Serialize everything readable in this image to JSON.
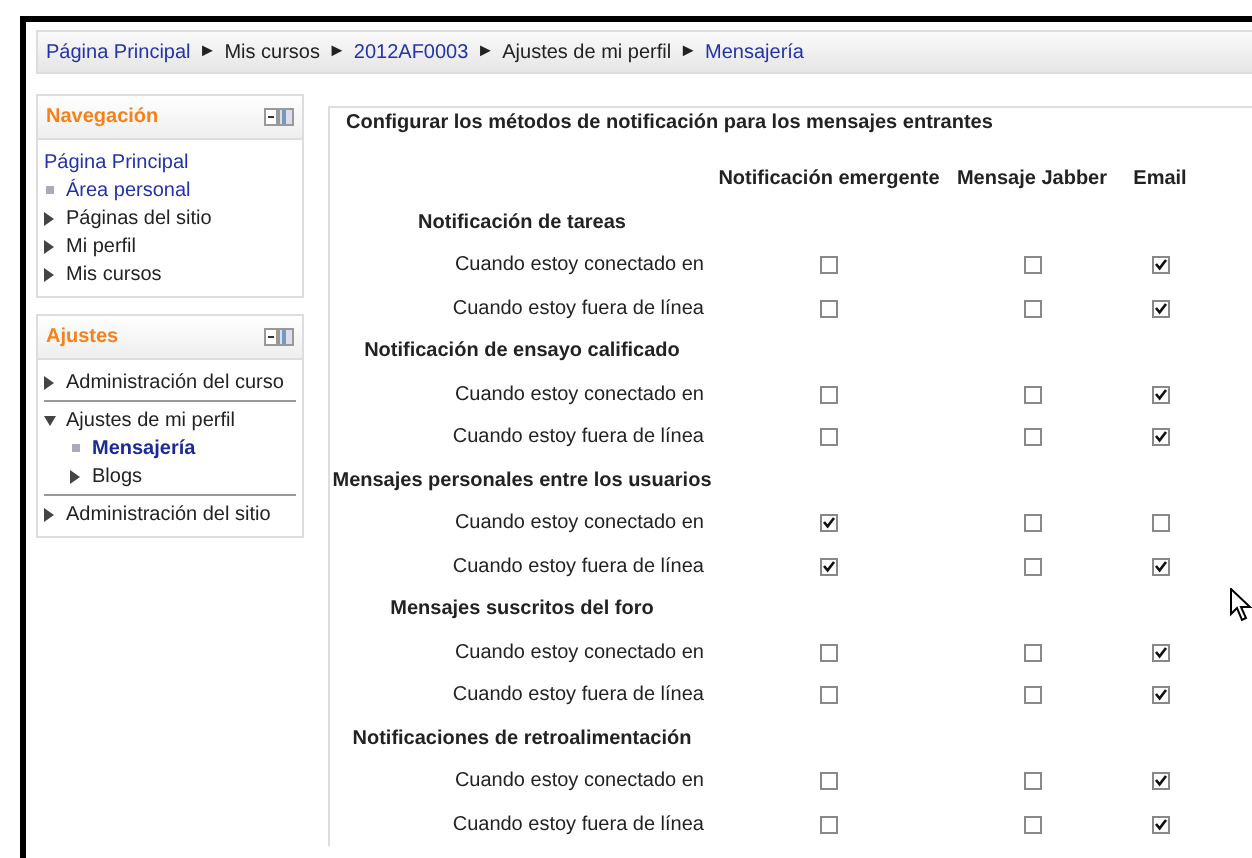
{
  "breadcrumb": [
    {
      "kind": "link",
      "text": "Página Principal"
    },
    {
      "kind": "separator",
      "text": "►"
    },
    {
      "kind": "text",
      "text": "Mis cursos"
    },
    {
      "kind": "separator",
      "text": "►"
    },
    {
      "kind": "link",
      "text": "2012AF0003"
    },
    {
      "kind": "separator",
      "text": "►"
    },
    {
      "kind": "text",
      "text": "Ajustes de mi perfil"
    },
    {
      "kind": "separator",
      "text": "►"
    },
    {
      "kind": "link",
      "text": "Mensajería"
    }
  ],
  "blocks": [
    {
      "title": "Navegación",
      "items": [
        {
          "kind": "plain",
          "text": "Página Principal"
        },
        {
          "kind": "leaf",
          "text": "Área personal",
          "selected": false
        },
        {
          "kind": "branch",
          "text": "Páginas del sitio",
          "expanded": false
        },
        {
          "kind": "branch",
          "text": "Mi perfil",
          "expanded": false
        },
        {
          "kind": "branch",
          "text": "Mis cursos",
          "expanded": false
        }
      ]
    },
    {
      "title": "Ajustes",
      "items": [
        {
          "kind": "branch",
          "text": "Administración del curso",
          "expanded": false
        },
        {
          "kind": "divider"
        },
        {
          "kind": "branch",
          "text": "Ajustes de mi perfil",
          "expanded": true,
          "children": [
            {
              "kind": "leaf",
              "text": "Mensajería",
              "selected": true
            },
            {
              "kind": "branch",
              "text": "Blogs",
              "expanded": false
            }
          ]
        },
        {
          "kind": "divider"
        },
        {
          "kind": "branch",
          "text": "Administración del sitio",
          "expanded": false
        }
      ]
    }
  ],
  "form": {
    "legend": "Configurar los métodos de notificación para los mensajes entrantes",
    "columns": [
      "Notificación emergente",
      "Mensaje Jabber",
      "Email"
    ],
    "groups": [
      {
        "title": "Notificación de tareas",
        "rows": [
          {
            "label": "Cuando estoy conectado en",
            "checks": [
              false,
              false,
              true
            ]
          },
          {
            "label": "Cuando estoy fuera de línea",
            "checks": [
              false,
              false,
              true
            ]
          }
        ]
      },
      {
        "title": "Notificación de ensayo calificado",
        "rows": [
          {
            "label": "Cuando estoy conectado en",
            "checks": [
              false,
              false,
              true
            ]
          },
          {
            "label": "Cuando estoy fuera de línea",
            "checks": [
              false,
              false,
              true
            ]
          }
        ]
      },
      {
        "title": "Mensajes personales entre los usuarios",
        "rows": [
          {
            "label": "Cuando estoy conectado en",
            "checks": [
              true,
              false,
              false
            ]
          },
          {
            "label": "Cuando estoy fuera de línea",
            "checks": [
              true,
              false,
              true
            ]
          }
        ]
      },
      {
        "title": "Mensajes suscritos del foro",
        "rows": [
          {
            "label": "Cuando estoy conectado en",
            "checks": [
              false,
              false,
              true
            ]
          },
          {
            "label": "Cuando estoy fuera de línea",
            "checks": [
              false,
              false,
              true
            ]
          }
        ]
      },
      {
        "title": "Notificaciones de retroalimentación",
        "rows": [
          {
            "label": "Cuando estoy conectado en",
            "checks": [
              false,
              false,
              true
            ]
          },
          {
            "label": "Cuando estoy fuera de línea",
            "checks": [
              false,
              false,
              true
            ]
          }
        ]
      }
    ]
  }
}
